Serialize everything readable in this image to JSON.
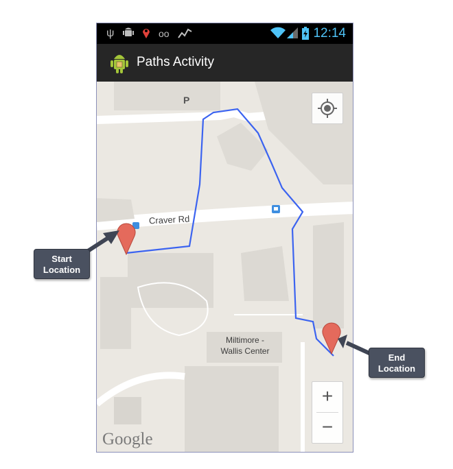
{
  "status_bar": {
    "icons": [
      "usb-icon",
      "android-debug-icon",
      "location-pin-icon",
      "voicemail-icon",
      "activity-chart-icon",
      "wifi-icon",
      "signal-icon",
      "battery-icon"
    ],
    "time": "12:14"
  },
  "action_bar": {
    "app_icon": "android-icon",
    "title": "Paths Activity"
  },
  "map": {
    "labels": {
      "parking": "P",
      "road": "Craver Rd",
      "building_line1": "Miltimore -",
      "building_line2": "Wallis Center"
    },
    "controls": {
      "locate_icon": "my-location-icon",
      "zoom_in": "+",
      "zoom_out": "−"
    },
    "logo": "Google",
    "route_color": "#3b63f0",
    "marker_color": "#e46a5c"
  },
  "callouts": {
    "start_line1": "Start",
    "start_line2": "Location",
    "end_line1": "End",
    "end_line2": "Location"
  }
}
